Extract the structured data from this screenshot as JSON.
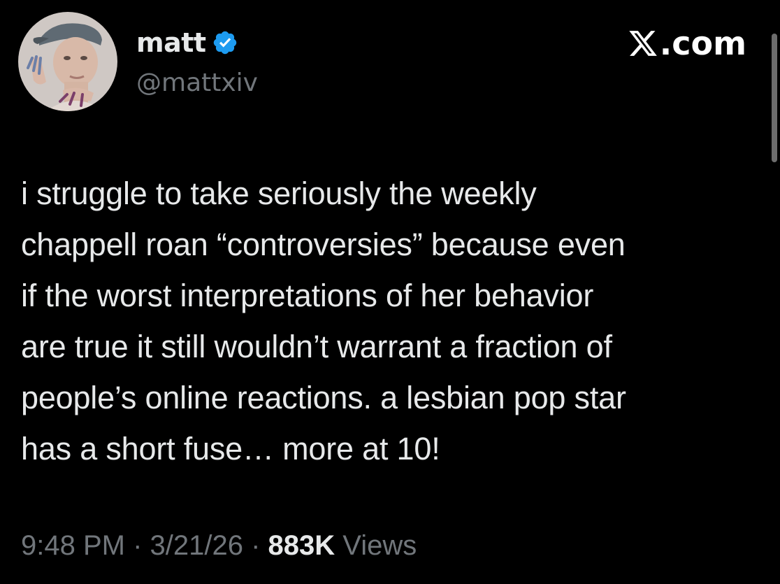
{
  "author": {
    "display_name": "matt",
    "handle": "@mattxiv",
    "verified": true,
    "verified_color": "#1d9bf0",
    "avatar_icon": "profile-photo"
  },
  "brand": {
    "icon": "x-logo-icon",
    "suffix": ".com"
  },
  "tweet": {
    "lines": [
      "i struggle to take seriously the weekly",
      "chappell roan “controversies” because even",
      "if the worst interpretations of her behavior",
      "are true it still wouldn’t warrant a fraction of",
      "people’s online reactions. a lesbian pop star",
      "has a short fuse… more at 10!"
    ]
  },
  "meta": {
    "time": "9:48 PM",
    "separator": " · ",
    "date": "3/21/26",
    "views_count": "883K",
    "views_label": "Views"
  },
  "colors": {
    "background": "#000000",
    "primary_text": "#e7e9ea",
    "secondary_text": "#71767b"
  }
}
